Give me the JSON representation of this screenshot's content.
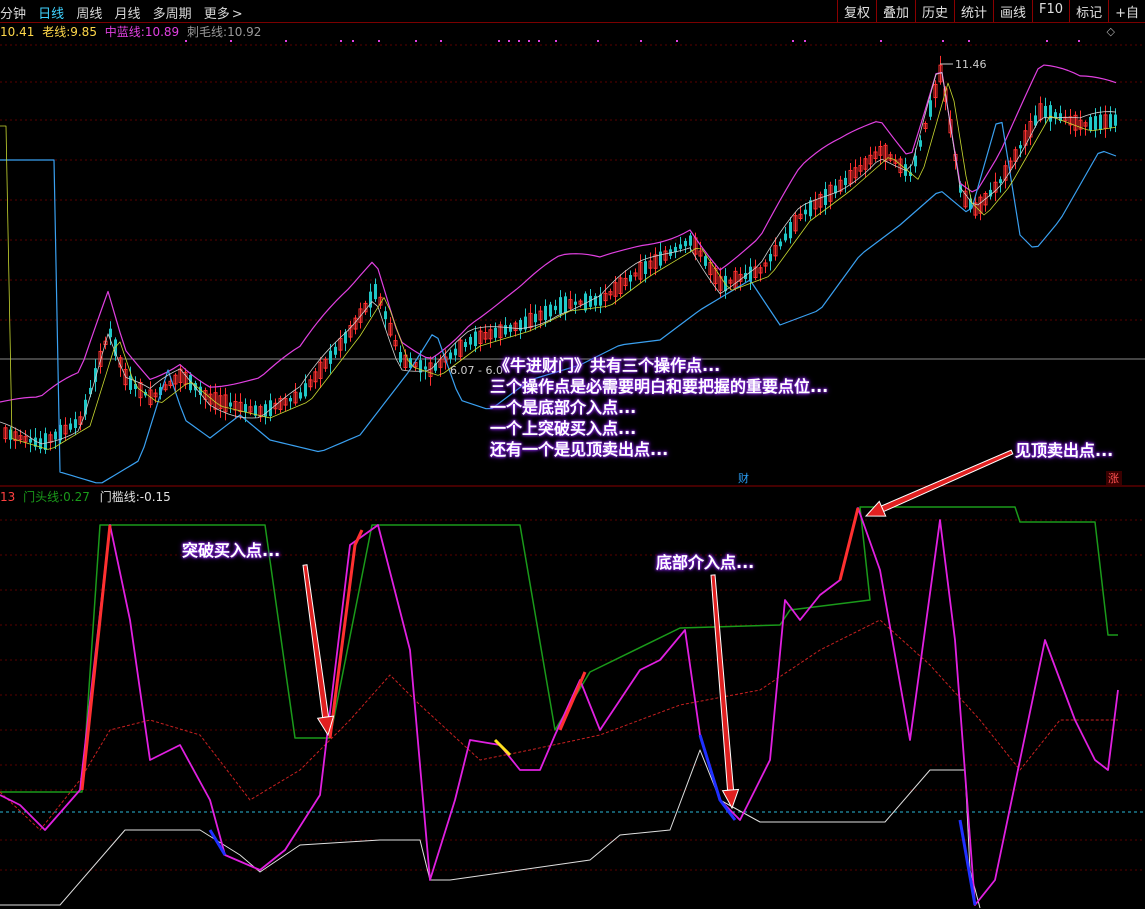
{
  "toolbar": {
    "left_tabs": [
      "分钟",
      "日线",
      "周线",
      "月线",
      "多周期",
      "更多"
    ],
    "right_tabs": [
      "复权",
      "叠加",
      "历史",
      "统计",
      "画线",
      "F10",
      "标记",
      "+自"
    ]
  },
  "main_legend": {
    "first_value": "10.41",
    "old_line_label": "老线:",
    "old_line_value": "9.85",
    "blue_line_label": "中蓝线:",
    "blue_line_value": "10.89",
    "thorn_line_label": "刺毛线:",
    "thorn_line_value": "10.92"
  },
  "price_labels": {
    "high_label": "11.46",
    "range_label": "6.07 - 6.0"
  },
  "markers": {
    "cai": "财",
    "zhang": "涨"
  },
  "sub_legend": {
    "prefix": "13",
    "gate_head_label": "门头线:",
    "gate_head_value": "0.27",
    "threshold_label": "门槛线:",
    "threshold_value": "-0.15"
  },
  "annotations": {
    "intro_lines": [
      "《牛进财门》共有三个操作点...",
      "三个操作点是必需要明白和要把握的重要点位...",
      "一个是底部介入点...",
      "一个上突破买入点...",
      "还有一个是见顶卖出点..."
    ],
    "breakout_buy": "突破买入点...",
    "bottom_entry": "底部介入点...",
    "top_sell": "见顶卖出点..."
  },
  "colors": {
    "background": "#000000",
    "panel_border": "#8a0000",
    "bull_candle": "#ff3030",
    "bear_candle": "#20c8c8",
    "upper_band": "#e040e0",
    "mid_line": "#3aa0f0",
    "gate_head": "#e020e0",
    "gate_green": "#1a9a1a",
    "threshold_white": "#e0e0e0",
    "callout_glow": "#7b1fd6"
  }
}
